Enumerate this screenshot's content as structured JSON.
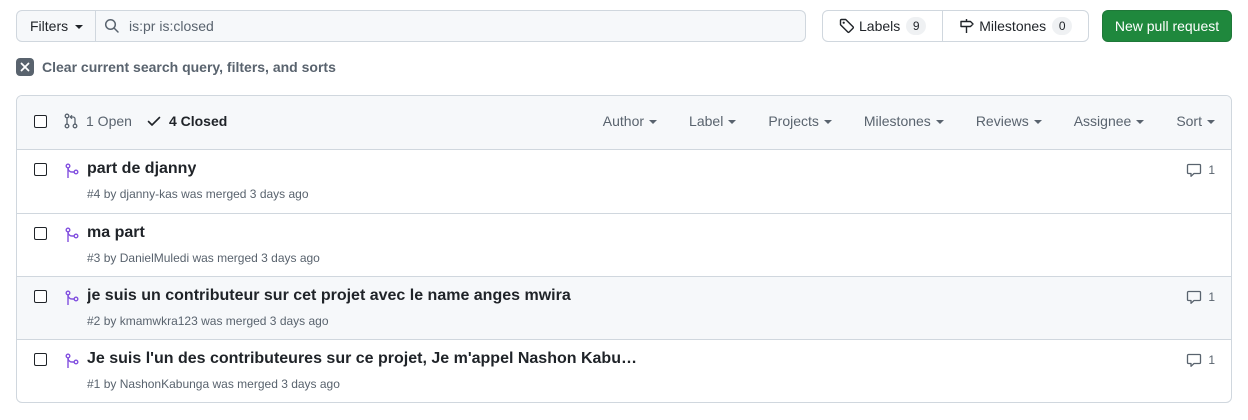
{
  "filters": {
    "label": "Filters"
  },
  "search": {
    "value": "is:pr is:closed"
  },
  "labels": {
    "label": "Labels",
    "count": "9"
  },
  "milestones": {
    "label": "Milestones",
    "count": "0"
  },
  "new_pr": {
    "label": "New pull request"
  },
  "clear": {
    "label": "Clear current search query, filters, and sorts"
  },
  "header": {
    "open_label": "1 Open",
    "closed_label": "4 Closed",
    "dropdowns": [
      "Author",
      "Label",
      "Projects",
      "Milestones",
      "Reviews",
      "Assignee",
      "Sort"
    ]
  },
  "pulls": [
    {
      "title": "part de djanny",
      "number": "#4",
      "by": "by",
      "author": "djanny-kas",
      "status": "was merged 3 days ago",
      "comments": "1"
    },
    {
      "title": "ma part",
      "number": "#3",
      "by": "by",
      "author": "DanielMuledi",
      "status": "was merged 3 days ago",
      "comments": ""
    },
    {
      "title": "je suis un contributeur sur cet projet avec le name anges mwira",
      "number": "#2",
      "by": "by",
      "author": "kmamwkra123",
      "status": "was merged 3 days ago",
      "comments": "1"
    },
    {
      "title": "Je suis l'un des contributeures sur ce projet, Je m'appel Nashon Kabu…",
      "number": "#1",
      "by": "by",
      "author": "NashonKabunga",
      "status": "was merged 3 days ago",
      "comments": "1"
    }
  ],
  "colors": {
    "merged": "#8250df",
    "primary": "#1f883d"
  }
}
